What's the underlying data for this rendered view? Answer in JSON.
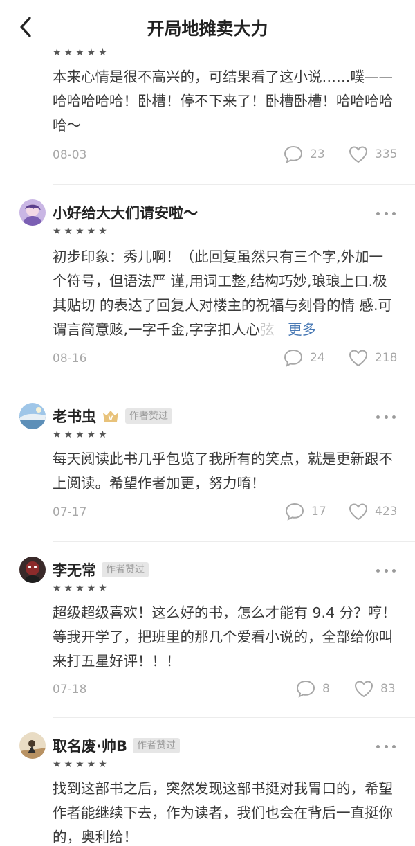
{
  "header": {
    "title": "开局地摊卖大力",
    "back_icon": "chevron-left-icon"
  },
  "reviews": [
    {
      "username": "",
      "stars": "★★★★★",
      "content": "本来心情是很不高兴的，可结果看了这小说……噗——哈哈哈哈哈！卧槽！停不下来了！卧槽卧槽！哈哈哈哈哈～",
      "date": "08-03",
      "comments": "23",
      "likes": "335"
    },
    {
      "username": "小好给大大们请安啦～",
      "stars": "★★★★★",
      "content": "初步印象：秀儿啊！（此回复虽然只有三个字,外加一个符号，但语法严 谨,用词工整,结构巧妙,琅琅上口.极其贴切 的表达了回复人对楼主的祝福与刻骨的情 感.可谓言简意赅,一字千金,字字扣人心",
      "fade_text": "弦",
      "more_label": "更多",
      "date": "08-16",
      "comments": "24",
      "likes": "218"
    },
    {
      "username": "老书虫",
      "author_tag": "作者赞过",
      "stars": "★★★★★",
      "content": "每天阅读此书几乎包览了我所有的笑点，就是更新跟不上阅读。希望作者加更，努力唷！",
      "date": "07-17",
      "comments": "17",
      "likes": "423"
    },
    {
      "username": "李无常",
      "author_tag": "作者赞过",
      "stars": "★★★★★",
      "content": "超级超级喜欢！这么好的书，怎么才能有 9.4 分？哼！等我开学了，把班里的那几个爱看小说的，全部给你叫来打五星好评！！！",
      "date": "07-18",
      "comments": "8",
      "likes": "83"
    },
    {
      "username": "取名废·帅B",
      "author_tag": "作者赞过",
      "stars": "★★★★★",
      "content": "找到这部书之后，突然发现这部书挺对我胃口的，希望作者能继续下去，作为读者，我们也会在背后一直挺你的，奥利给！"
    }
  ],
  "colors": {
    "link": "#4a7ab5",
    "meta": "#a8a8a8",
    "badge": "#e8c27a"
  }
}
